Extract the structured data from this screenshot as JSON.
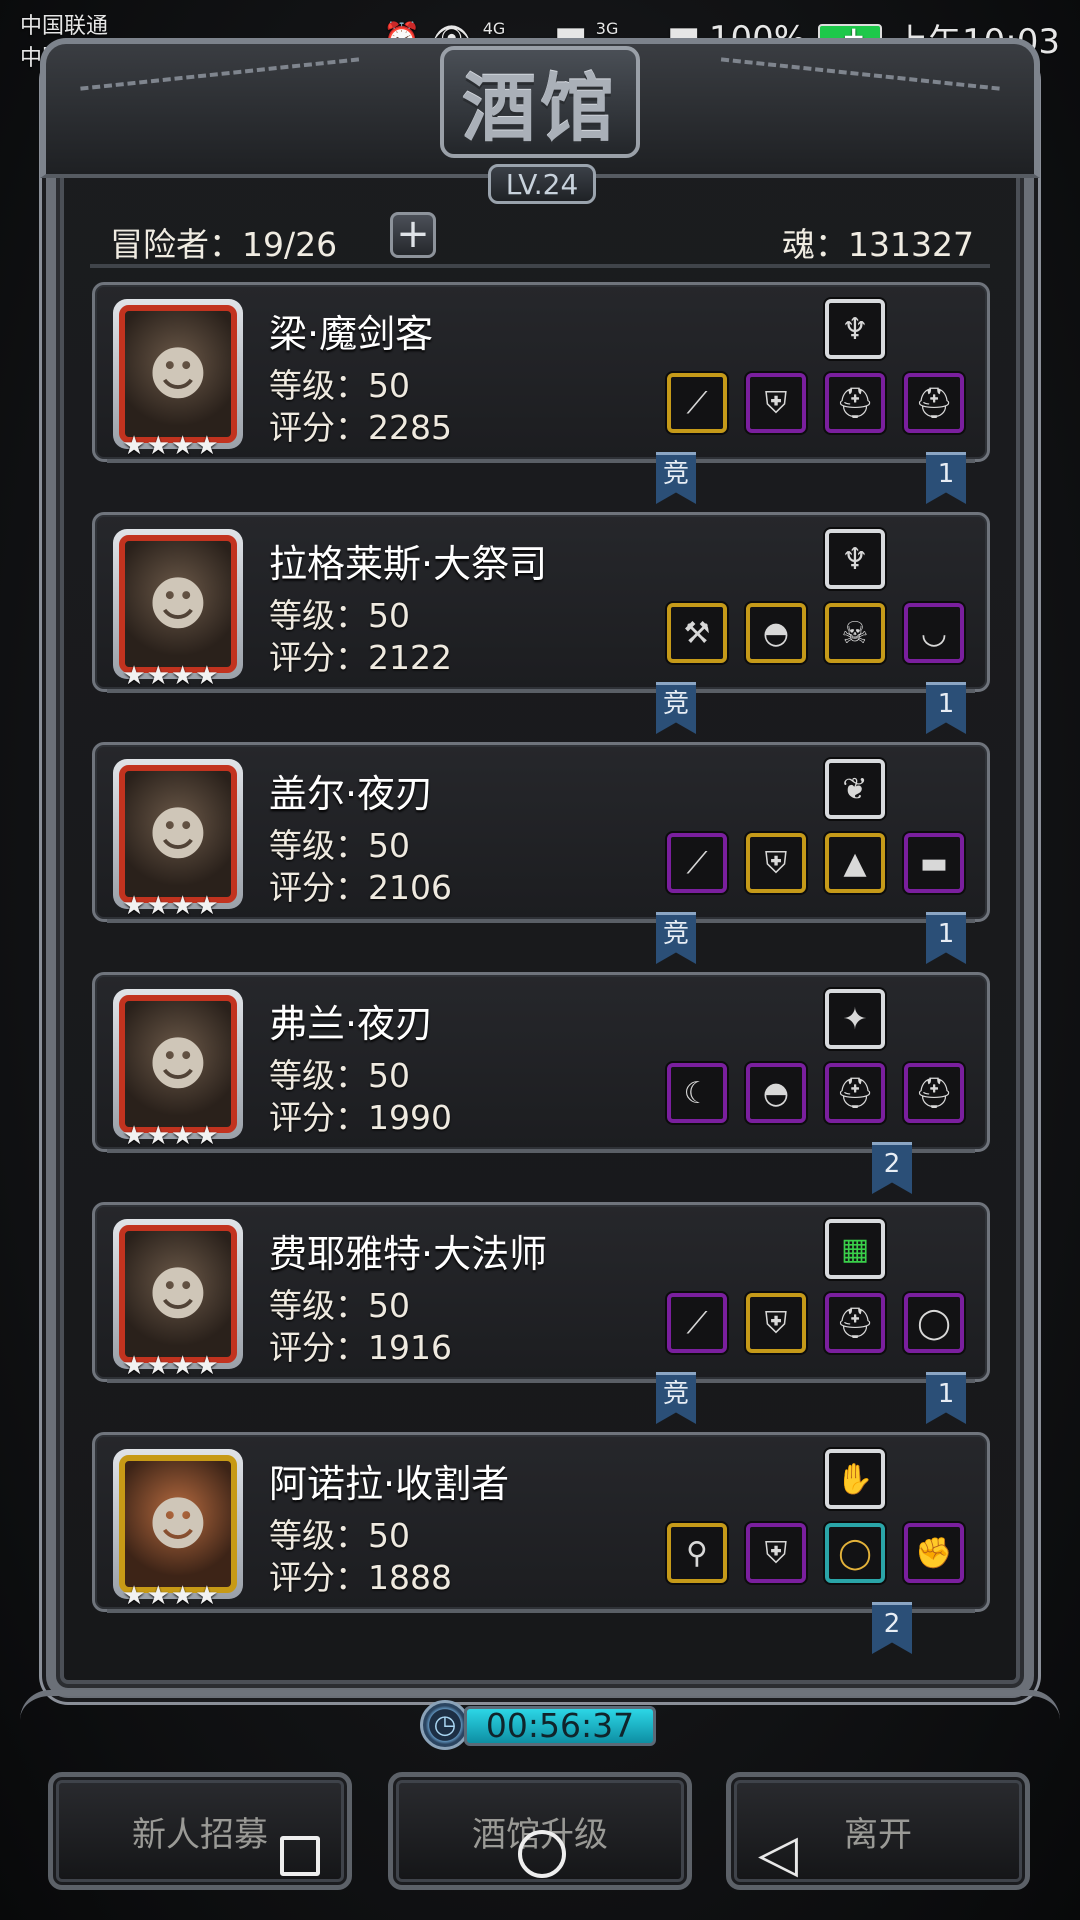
{
  "status_bar": {
    "carrier_1": "中国联通",
    "carrier_2": "中国联通",
    "battery": "100%",
    "time": "上午10:03",
    "net_1": "4G",
    "net_2": "3G"
  },
  "header": {
    "title": "酒馆",
    "level": "LV.24",
    "adventurers": "冒险者：19/26",
    "add_label": "+",
    "soul": "魂：131327"
  },
  "heroes": [
    {
      "name": "梁·魔剑客",
      "level": "等级：50",
      "score": "评分：2285",
      "stars": "★★★★",
      "ribbons": [
        "竞",
        "1"
      ]
    },
    {
      "name": "拉格莱斯·大祭司",
      "level": "等级：50",
      "score": "评分：2122",
      "stars": "★★★★",
      "ribbons": [
        "竞",
        "1"
      ]
    },
    {
      "name": "盖尔·夜刃",
      "level": "等级：50",
      "score": "评分：2106",
      "stars": "★★★★",
      "ribbons": [
        "竞",
        "1"
      ]
    },
    {
      "name": "弗兰·夜刃",
      "level": "等级：50",
      "score": "评分：1990",
      "stars": "★★★★",
      "ribbons": [
        "2"
      ]
    },
    {
      "name": "费耶雅特·大法师",
      "level": "等级：50",
      "score": "评分：1916",
      "stars": "★★★★",
      "ribbons": [
        "竞",
        "1"
      ]
    },
    {
      "name": "阿诺拉·收割者",
      "level": "等级：50",
      "score": "评分：1888",
      "stars": "★★★★",
      "ribbons": [
        "2"
      ]
    }
  ],
  "timer": "00:56:37",
  "buttons": {
    "recruit": "新人招募",
    "upgrade": "酒馆升级",
    "leave": "离开"
  }
}
